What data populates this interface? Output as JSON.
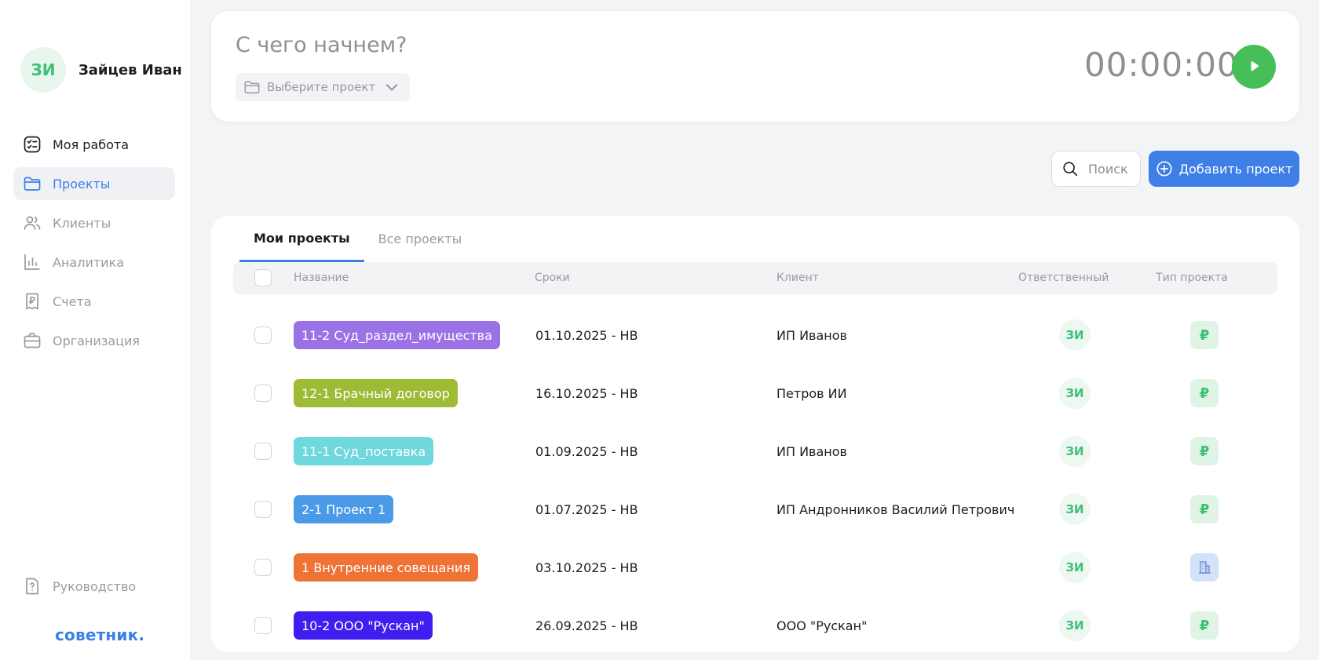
{
  "user": {
    "initials": "ЗИ",
    "name": "Зайцев Иван"
  },
  "nav": {
    "items": [
      {
        "label": "Моя работа"
      },
      {
        "label": "Проекты"
      },
      {
        "label": "Клиенты"
      },
      {
        "label": "Аналитика"
      },
      {
        "label": "Счета"
      },
      {
        "label": "Организация"
      }
    ],
    "guide": "Руководство",
    "brand": "советник."
  },
  "timer": {
    "prompt": "С чего начнем?",
    "project_select": "Выберите проект",
    "time": "00:00:00"
  },
  "toolbar": {
    "search_placeholder": "Поиск",
    "add_label": "Добавить проект"
  },
  "tabs": [
    {
      "label": "Мои проекты"
    },
    {
      "label": "Все проекты"
    }
  ],
  "columns": {
    "name": "Название",
    "dates": "Сроки",
    "client": "Клиент",
    "owner": "Ответственный",
    "type": "Тип проекта"
  },
  "rows": [
    {
      "name": "11-2 Суд_раздел_имущества",
      "color": "#9b72e6",
      "dates": "01.10.2025 - НВ",
      "client": "ИП Иванов",
      "owner": "ЗИ",
      "type": "ruble",
      "type_symbol": "₽"
    },
    {
      "name": "12-1 Брачный договор",
      "color": "#9dbb35",
      "dates": "16.10.2025 - НВ",
      "client": "Петров ИИ",
      "owner": "ЗИ",
      "type": "ruble",
      "type_symbol": "₽"
    },
    {
      "name": "11-1 Суд_поставка",
      "color": "#6fd8dc",
      "dates": "01.09.2025 - НВ",
      "client": "ИП Иванов",
      "owner": "ЗИ",
      "type": "ruble",
      "type_symbol": "₽"
    },
    {
      "name": "2-1 Проект 1",
      "color": "#4a9ae8",
      "dates": "01.07.2025 - НВ",
      "client": "ИП Андронников Василий Петрович",
      "owner": "ЗИ",
      "type": "ruble",
      "type_symbol": "₽"
    },
    {
      "name": "1 Внутренние совещания",
      "color": "#ee7335",
      "dates": "03.10.2025 - НВ",
      "client": "",
      "owner": "ЗИ",
      "type": "organization",
      "type_symbol": ""
    },
    {
      "name": "10-2 ООО \"Рускан\"",
      "color": "#3e1ff0",
      "dates": "26.09.2025 - НВ",
      "client": "ООО \"Рускан\"",
      "owner": "ЗИ",
      "type": "ruble",
      "type_symbol": "₽"
    }
  ]
}
